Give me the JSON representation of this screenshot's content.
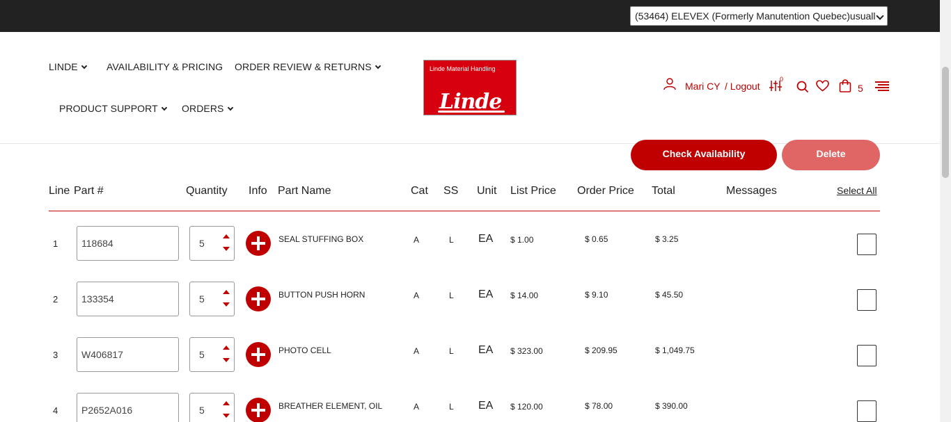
{
  "topbar": {
    "account_selected": "(53464) ELEVEX (Formerly Manutention Quebec)usuall"
  },
  "nav": {
    "linde": "LINDE",
    "availability": "AVAILABILITY & PRICING",
    "order_review": "ORDER REVIEW & RETURNS",
    "product_support": "PRODUCT SUPPORT",
    "orders": "ORDERS"
  },
  "logo": {
    "small_text": "Linde Material Handling",
    "brand": "Linde"
  },
  "user": {
    "name": "Mari CY",
    "logout": "/ Logout",
    "compare_count": "0",
    "cart_count": "5"
  },
  "actions": {
    "check_availability": "Check Availability",
    "delete": "Delete"
  },
  "table": {
    "headers": {
      "line": "Line",
      "part": "Part #",
      "quantity": "Quantity",
      "info": "Info",
      "part_name": "Part Name",
      "cat": "Cat",
      "ss": "SS",
      "unit": "Unit",
      "list_price": "List Price",
      "order_price": "Order Price",
      "total": "Total",
      "messages": "Messages",
      "select_all": "Select All"
    },
    "rows": [
      {
        "line": "1",
        "part": "118684",
        "qty": "5",
        "name": "SEAL STUFFING BOX",
        "cat": "A",
        "ss": "L",
        "unit": "EA",
        "list": "$ 1.00",
        "order": "$ 0.65",
        "total": "$ 3.25"
      },
      {
        "line": "2",
        "part": "133354",
        "qty": "5",
        "name": "BUTTON PUSH HORN",
        "cat": "A",
        "ss": "L",
        "unit": "EA",
        "list": "$ 14.00",
        "order": "$ 9.10",
        "total": "$ 45.50"
      },
      {
        "line": "3",
        "part": "W406817",
        "qty": "5",
        "name": "PHOTO CELL",
        "cat": "A",
        "ss": "L",
        "unit": "EA",
        "list": "$ 323.00",
        "order": "$ 209.95",
        "total": "$ 1,049.75"
      },
      {
        "line": "4",
        "part": "P2652A016",
        "qty": "5",
        "name": "BREATHER ELEMENT, OIL",
        "cat": "A",
        "ss": "L",
        "unit": "EA",
        "list": "$ 120.00",
        "order": "$ 78.00",
        "total": "$ 390.00"
      }
    ]
  },
  "colors": {
    "brand_red": "#c00000",
    "logo_red": "#d7000f",
    "delete_pink": "#e06666",
    "topbar": "#222222"
  }
}
